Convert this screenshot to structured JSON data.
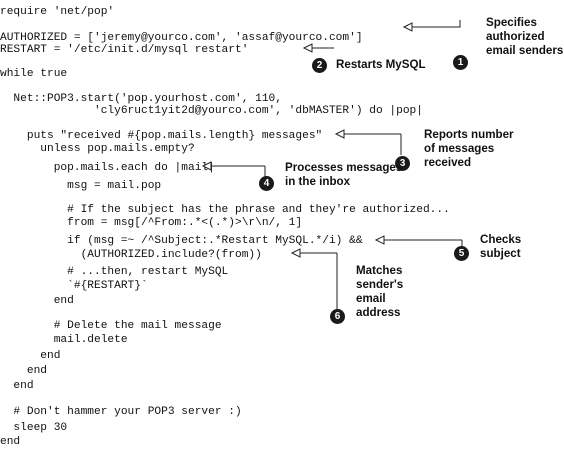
{
  "code_lines": [
    "require 'net/pop'",
    "",
    "AUTHORIZED = ['jeremy@yourco.com', 'assaf@yourco.com']",
    "RESTART = '/etc/init.d/mysql restart'",
    "",
    "while true",
    "",
    "  Net::POP3.start('pop.yourhost.com', 110,",
    "              'cly6ruct1yit2d@yourco.com', 'dbMASTER') do |pop|",
    "",
    "    puts \"received #{pop.mails.length} messages\"",
    "      unless pop.mails.empty?",
    "        pop.mails.each do |mail|",
    "          msg = mail.pop",
    "",
    "          # If the subject has the phrase and they're authorized...",
    "          from = msg[/^From:.*<(.*)>\\r\\n/, 1]",
    "          if (msg =~ /^Subject:.*Restart MySQL.*/i) &&",
    "            (AUTHORIZED.include?(from))",
    "          # ...then, restart MySQL",
    "          `#{RESTART}`",
    "        end",
    "",
    "        # Delete the mail message",
    "        mail.delete",
    "      end",
    "    end",
    "  end",
    "",
    "  # Don't hammer your POP3 server :)",
    "  sleep 30",
    "end"
  ],
  "annotations": [
    {
      "number": "1",
      "text": "Specifies\nauthorized\nemail senders"
    },
    {
      "number": "2",
      "text": "Restarts MySQL"
    },
    {
      "number": "3",
      "text": "Reports number\nof messages\nreceived"
    },
    {
      "number": "4",
      "text": "Processes messages\nin the inbox"
    },
    {
      "number": "5",
      "text": "Checks\nsubject"
    },
    {
      "number": "6",
      "text": "Matches\nsender's\nemail\naddress"
    }
  ]
}
